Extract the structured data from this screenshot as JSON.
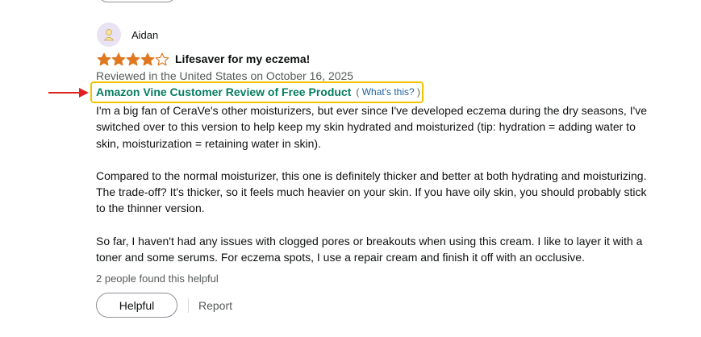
{
  "review": {
    "profile_name": "Aidan",
    "rating": 4,
    "rating_max": 5,
    "title": "Lifesaver for my eczema!",
    "meta": "Reviewed in the United States on October 16, 2025",
    "vine_label": "Amazon Vine Customer Review of Free Product",
    "whats_this_open": "(",
    "whats_this": "What's this?",
    "whats_this_close": ")",
    "paragraphs": [
      "I'm a big fan of CeraVe's other moisturizers, but ever since I've developed eczema during the dry seasons, I've switched over to this version to help keep my skin hydrated and moisturized (tip: hydration = adding water to skin, moisturization = retaining water in skin).",
      "Compared to the normal moisturizer, this one is definitely thicker and better at both hydrating and moisturizing. The trade-off? It's thicker, so it feels much heavier on your skin. If you have oily skin, you should probably stick to the thinner version.",
      "So far, I haven't had any issues with clogged pores or breakouts when using this cream. I like to layer it with a toner and some serums. For eczema spots, I use a repair cream and finish it off with an occlusive."
    ],
    "helpful_count": "2 people found this helpful",
    "helpful_button": "Helpful",
    "report_link": "Report"
  },
  "colors": {
    "star": "#de7921",
    "vine_green": "#067d62",
    "highlight_box": "#f2c400",
    "arrow": "#e02020",
    "link": "#2162a1"
  },
  "icons": {
    "avatar": "default-avatar-icon",
    "star_full": "star-filled-icon",
    "star_empty": "star-empty-icon",
    "arrow": "right-arrow-icon"
  }
}
